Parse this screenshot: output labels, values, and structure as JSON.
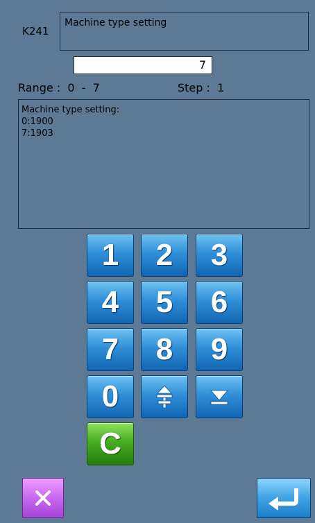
{
  "header": {
    "code": "K241",
    "title": "Machine type setting"
  },
  "input": {
    "value": "7"
  },
  "range": {
    "range_label": "Range :  0  -  7",
    "step_label": "Step :  1"
  },
  "description": {
    "lines": [
      "Machine type setting:",
      "0:1900",
      "7:1903"
    ]
  },
  "keypad": {
    "keys": [
      "1",
      "2",
      "3",
      "4",
      "5",
      "6",
      "7",
      "8",
      "9",
      "0"
    ],
    "sign_icon": "plus-minus-icon",
    "down_icon": "arrow-down-icon",
    "clear_label": "C"
  },
  "footer": {
    "cancel_icon": "close-icon",
    "enter_icon": "enter-icon"
  },
  "colors": {
    "background": "#5c7a96",
    "key_blue": "#2f8fd8",
    "key_green": "#47ad23",
    "cancel_purple": "#c967f0",
    "enter_blue": "#3ea3e6"
  }
}
